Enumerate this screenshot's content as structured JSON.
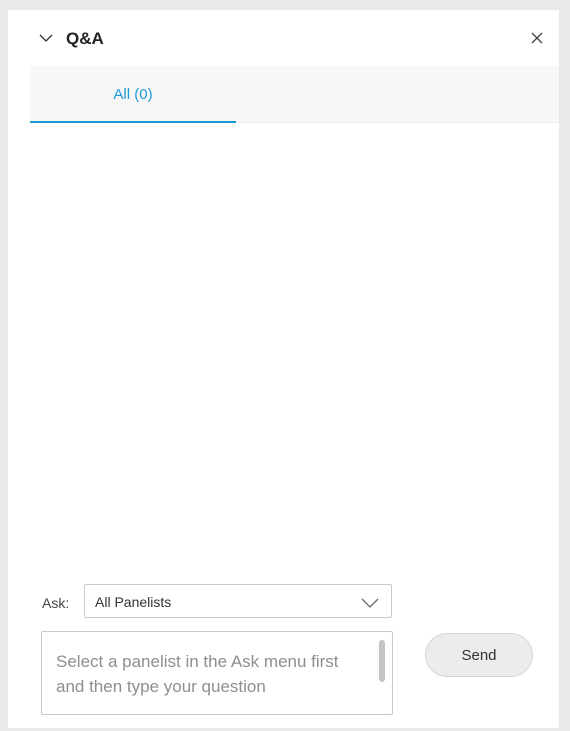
{
  "header": {
    "title": "Q&A",
    "collapse_icon": "chevron-down-icon",
    "close_icon": "close-icon"
  },
  "tabs": [
    {
      "label": "All (0)",
      "active": true
    }
  ],
  "ask": {
    "label": "Ask:",
    "selected": "All Panelists",
    "dropdown_icon": "chevron-down-icon"
  },
  "question": {
    "value": "",
    "placeholder": "Select a panelist in the Ask menu first and then type your question"
  },
  "send_label": "Send",
  "colors": {
    "accent": "#1a9ad6",
    "background": "#ffffff",
    "frame": "#e9e9e9"
  }
}
